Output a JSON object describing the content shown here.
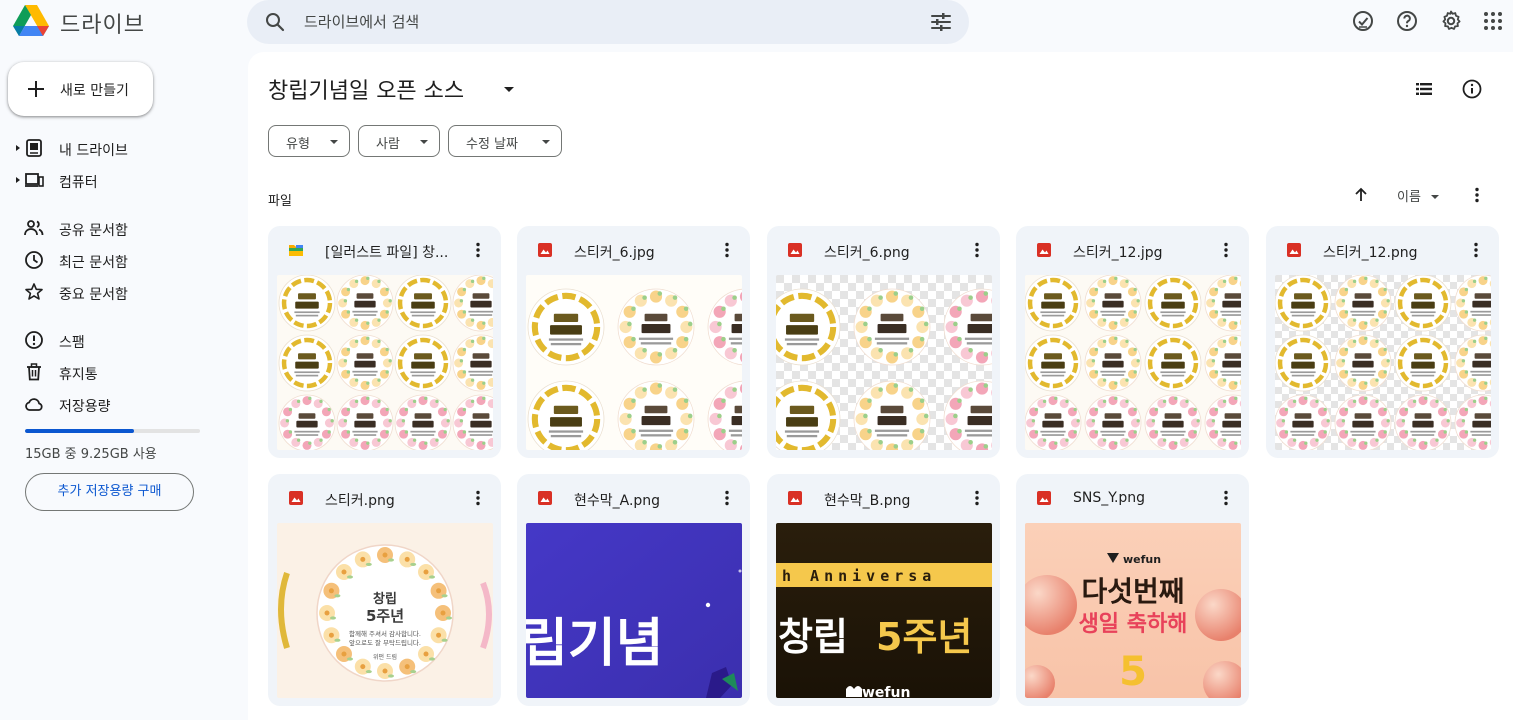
{
  "app": {
    "name": "드라이브"
  },
  "search": {
    "placeholder": "드라이브에서 검색"
  },
  "sidebar": {
    "new_label": "새로 만들기",
    "items": [
      {
        "label": "내 드라이브",
        "icon": "my-drive-icon"
      },
      {
        "label": "컴퓨터",
        "icon": "computer-icon"
      },
      {
        "label": "공유 문서함",
        "icon": "people-icon"
      },
      {
        "label": "최근 문서함",
        "icon": "clock-icon"
      },
      {
        "label": "중요 문서함",
        "icon": "star-icon"
      },
      {
        "label": "스팸",
        "icon": "spam-icon"
      },
      {
        "label": "휴지통",
        "icon": "trash-icon"
      },
      {
        "label": "저장용량",
        "icon": "cloud-icon"
      }
    ],
    "storage_text": "15GB 중 9.25GB 사용",
    "storage_used_fraction": 0.62,
    "buy_label": "추가 저장용량 구매"
  },
  "main": {
    "folder_title": "창립기념일 오픈 소스",
    "filters": [
      "유형",
      "사람",
      "수정 날짜"
    ],
    "section_label": "파일",
    "sort_label": "이름",
    "files": [
      {
        "name": "[일러스트 파일] 창...",
        "type": "folder",
        "thumb": "sticker-grid-mixed"
      },
      {
        "name": "스티커_6.jpg",
        "type": "image",
        "thumb": "sticker-six"
      },
      {
        "name": "스티커_6.png",
        "type": "image",
        "thumb": "sticker-six-transparent"
      },
      {
        "name": "스티커_12.jpg",
        "type": "image",
        "thumb": "sticker-grid"
      },
      {
        "name": "스티커_12.png",
        "type": "image",
        "thumb": "sticker-grid-transparent"
      },
      {
        "name": "스티커.png",
        "type": "image",
        "thumb": "sticker-single",
        "thumb_text": [
          "창립",
          "5주년",
          "함께해 주셔서 감사합니다.",
          "앞으로도 잘 부탁드립니다.",
          "위펀 드림"
        ]
      },
      {
        "name": "현수막_A.png",
        "type": "image",
        "thumb": "banner-purple",
        "thumb_text": [
          "립기념"
        ]
      },
      {
        "name": "현수막_B.png",
        "type": "image",
        "thumb": "banner-dark",
        "thumb_text": [
          "h Anniversa",
          "창립",
          "5주년",
          "wefun"
        ]
      },
      {
        "name": "SNS_Y.png",
        "type": "image",
        "thumb": "sns-peach",
        "thumb_text": [
          "wefun",
          "다섯번째",
          "생일 축하해",
          "5"
        ]
      }
    ]
  },
  "colors": {
    "accent": "#0b57d0",
    "card_bg": "#f0f4f9",
    "image_icon": "#d93025",
    "banner_purple": "#4136b8",
    "banner_gold": "#f5c84c"
  }
}
